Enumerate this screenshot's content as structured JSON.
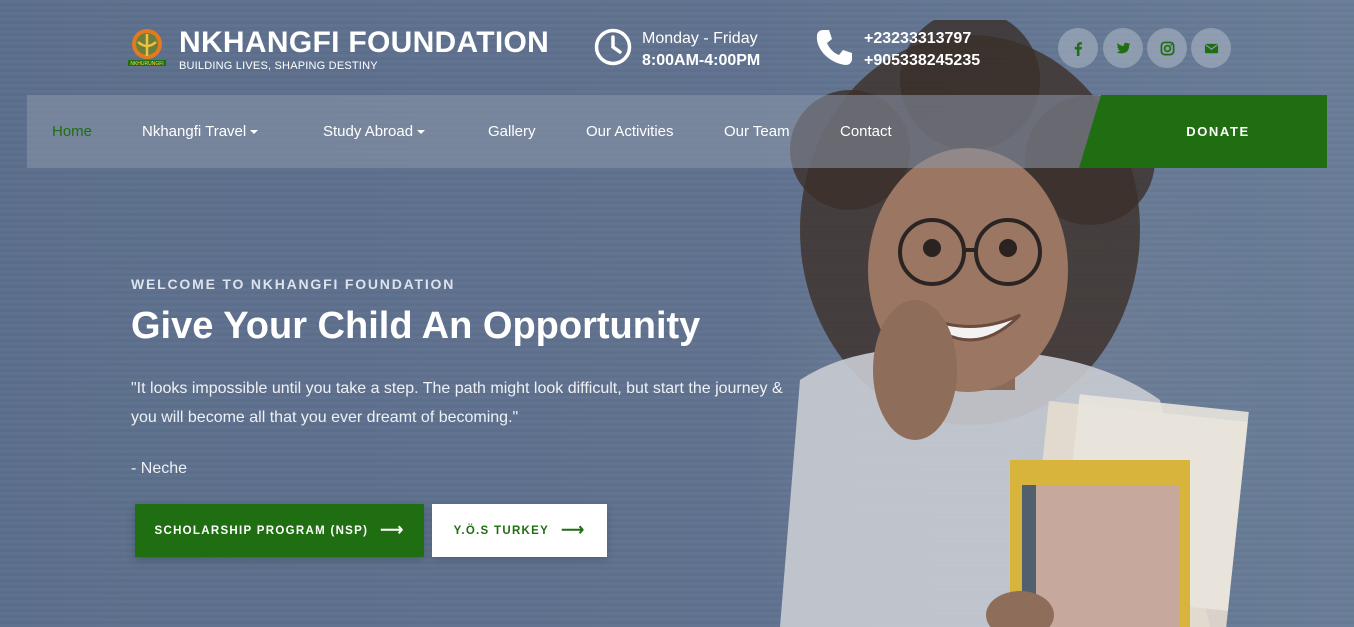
{
  "brand": {
    "logo_text": "NKHURUNGFI",
    "title": "NKHANGFI FOUNDATION",
    "tagline": "BUILDING LIVES, SHAPING DESTINY"
  },
  "hours": {
    "days": "Monday - Friday",
    "time": "8:00AM-4:00PM",
    "icon": "clock-icon"
  },
  "contact": {
    "phone_1": "+23233313797",
    "phone_2": "+905338245235",
    "icon": "phone-icon"
  },
  "social": [
    {
      "name": "facebook-icon"
    },
    {
      "name": "twitter-icon"
    },
    {
      "name": "instagram-icon"
    },
    {
      "name": "envelope-icon"
    }
  ],
  "nav": {
    "items": [
      {
        "label": "Home",
        "active": true
      },
      {
        "label": "Nkhangfi Travel",
        "dropdown": true
      },
      {
        "label": "Study Abroad",
        "dropdown": true
      },
      {
        "label": "Gallery"
      },
      {
        "label": "Our Activities"
      },
      {
        "label": "Our Team"
      },
      {
        "label": "Contact"
      }
    ],
    "donate_label": "DONATE"
  },
  "hero": {
    "eyebrow": "WELCOME TO NKHANGFI FOUNDATION",
    "headline": "Give Your Child An Opportunity",
    "quote": "\"It looks impossible until you take a step. The path might look difficult, but start the journey & you will become all that you ever dreamt of becoming.\"",
    "author": "- Neche",
    "buttons": [
      {
        "label": "SCHOLARSHIP PROGRAM (NSP)",
        "style": "primary"
      },
      {
        "label": "Y.Ö.S TURKEY",
        "style": "secondary"
      }
    ]
  },
  "colors": {
    "accent_green": "#1f6e12",
    "overlay": "#5f718e",
    "text": "#ffffff"
  }
}
